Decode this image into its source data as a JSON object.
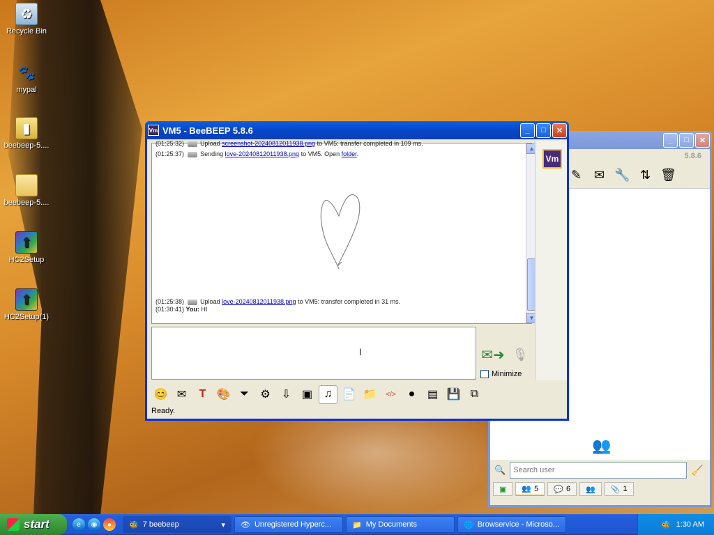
{
  "desktop": {
    "icons": [
      {
        "label": "Recycle Bin",
        "icon": "recycle-bin-icon"
      },
      {
        "label": "mypal",
        "icon": "mypal-icon"
      },
      {
        "label": "beebeep-5....",
        "icon": "zip-archive-icon"
      },
      {
        "label": "beebeep-5....",
        "icon": "folder-icon"
      },
      {
        "label": "HC2Setup",
        "icon": "winrar-installer-icon"
      },
      {
        "label": "HC2Setup(1)",
        "icon": "winrar-installer-icon"
      }
    ]
  },
  "chat_window": {
    "title": "VM5 - BeeBEEP 5.8.6",
    "messages": [
      {
        "time": "(01:25:32)",
        "pre": "Upload",
        "link": "screenshot-20240812011938.png",
        "post": "to VM5: transfer completed in 109 ms."
      },
      {
        "time": "(01:25:37)",
        "pre": "Sending",
        "link": "love-20240812011938.png",
        "post": "to VM5. Open",
        "link2": "folder",
        "tail": "."
      },
      {
        "time": "(01:25:38)",
        "pre": "Upload",
        "link": "love-20240812011938.png",
        "post": "to VM5: transfer completed in 31 ms."
      },
      {
        "time": "(01:30:41)",
        "sender": "You:",
        "text": "HI"
      }
    ],
    "avatar_badge": "Vm",
    "input_value": "",
    "minimize_label": "Minimize",
    "status": "Ready."
  },
  "user_window": {
    "version": "5.8.6",
    "search_placeholder": "Search user",
    "tabs": [
      {
        "icon": "chat-icon",
        "count": ""
      },
      {
        "icon": "users-icon",
        "count": "5"
      },
      {
        "icon": "conversations-icon",
        "count": "6"
      },
      {
        "icon": "groups-icon",
        "count": ""
      },
      {
        "icon": "shares-icon",
        "count": "1"
      }
    ]
  },
  "taskbar": {
    "start_label": "start",
    "tasks": [
      {
        "label": "7 beebeep",
        "icon": "beebeep-icon"
      },
      {
        "label": "Unregistered Hyperc...",
        "icon": "hypercam-icon"
      },
      {
        "label": "My Documents",
        "icon": "folder-icon"
      },
      {
        "label": "Browservice - Microso...",
        "icon": "browser-icon"
      }
    ],
    "clock": "1:30 AM"
  }
}
